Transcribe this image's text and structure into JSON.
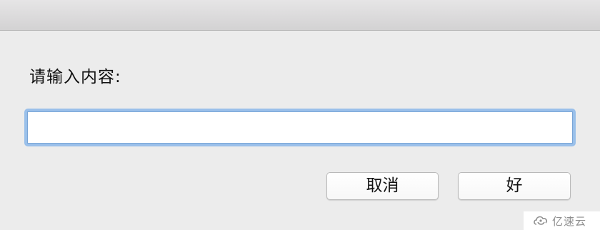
{
  "dialog": {
    "prompt": "请输入内容:",
    "input": {
      "value": "",
      "placeholder": ""
    },
    "buttons": {
      "cancel_label": "取消",
      "ok_label": "好"
    }
  },
  "watermark": {
    "text": "亿速云",
    "icon": "cloud-logo-icon"
  },
  "colors": {
    "background": "#ececec",
    "focus_ring": "#9ac0ea",
    "titlebar": "#d9d8d9"
  }
}
